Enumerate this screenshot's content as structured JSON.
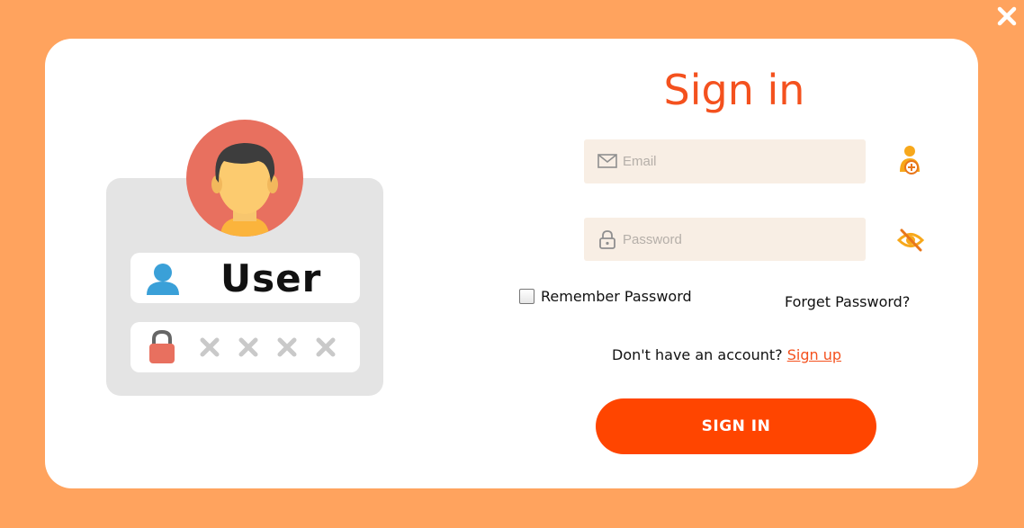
{
  "window": {
    "close_icon": "close-icon"
  },
  "illustration": {
    "user_label": "User",
    "password_mask": [
      "x",
      "x",
      "x",
      "x"
    ],
    "colors": {
      "panel": "#E4E4E4",
      "avatar_bg": "#E8705F",
      "user_icon": "#3AA0D8",
      "lock_icon": "#E8705F"
    }
  },
  "form": {
    "title": "Sign in",
    "email": {
      "placeholder": "Email",
      "value": "",
      "icon": "mail-icon"
    },
    "password": {
      "placeholder": "Password",
      "value": "",
      "icon": "lock-icon"
    },
    "email_side_icon": "user-badge-icon",
    "password_side_icon": "eye-slash-icon",
    "remember_label": "Remember Password",
    "remember_checked": false,
    "forget_label": "Forget Password?",
    "no_account_text": "Don't have an account?",
    "signup_label": "Sign up",
    "submit_label": "SIGN IN"
  },
  "colors": {
    "background": "#FFA35E",
    "accent": "#FF4500",
    "title": "#F4511E",
    "field_bg": "#F8EEE4"
  }
}
